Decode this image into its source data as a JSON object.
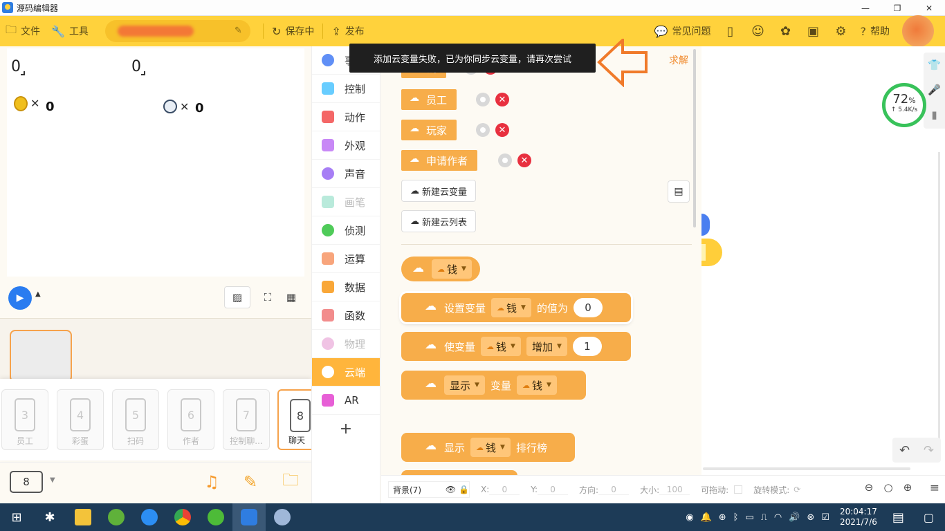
{
  "window": {
    "title": "源码编辑器",
    "controls": [
      "—",
      "❐",
      "✕"
    ]
  },
  "toolbar": {
    "file": "文件",
    "tools": "工具",
    "saving": "保存中",
    "publish": "发布",
    "faq": "常见问题",
    "help": "帮助"
  },
  "stage": {
    "var1": "0",
    "var2": "0",
    "coins": "0",
    "timer": "0",
    "x_mark": "✕"
  },
  "scenes": [
    {
      "num": "3",
      "label": "员工"
    },
    {
      "num": "4",
      "label": "彩蛋"
    },
    {
      "num": "5",
      "label": "扫码"
    },
    {
      "num": "6",
      "label": "作者"
    },
    {
      "num": "7",
      "label": "控制聊..."
    },
    {
      "num": "8",
      "label": "聊天"
    }
  ],
  "scene_selector": "8",
  "categories": [
    {
      "label": "事件",
      "color": "#608ff6",
      "disabled": false
    },
    {
      "label": "控制",
      "color": "#68cdff",
      "disabled": false
    },
    {
      "label": "动作",
      "color": "#f46767",
      "disabled": false
    },
    {
      "label": "外观",
      "color": "#c888f6",
      "disabled": false
    },
    {
      "label": "声音",
      "color": "#a77ef5",
      "disabled": false
    },
    {
      "label": "画笔",
      "color": "#7fd6bd",
      "disabled": true
    },
    {
      "label": "侦测",
      "color": "#4fcb59",
      "disabled": false
    },
    {
      "label": "运算",
      "color": "#f8a57c",
      "disabled": false
    },
    {
      "label": "数据",
      "color": "#f9a738",
      "disabled": false
    },
    {
      "label": "函数",
      "color": "#f28c8c",
      "disabled": false
    },
    {
      "label": "物理",
      "color": "#e08cc7",
      "disabled": true
    },
    {
      "label": "云端",
      "color": "#ffffff",
      "disabled": false
    },
    {
      "label": "AR",
      "color": "#e75fd6",
      "disabled": false
    }
  ],
  "palette": {
    "qiujie": "求解",
    "cloud_vars": [
      "钱",
      "员工",
      "玩家",
      "申请作者"
    ],
    "new_cloud_var": "新建云变量",
    "new_cloud_list": "新建云列表",
    "reporter_var": "钱",
    "set_block": {
      "prefix": "设置变量",
      "var": "钱",
      "middle": "的值为",
      "value": "0"
    },
    "change_block": {
      "prefix": "使变量",
      "var": "钱",
      "op": "增加",
      "value": "1"
    },
    "show_block": {
      "mode": "显示",
      "middle": "变量",
      "var": "钱"
    },
    "leaderboard_block": {
      "mode": "显示",
      "var": "钱",
      "suffix": "排行榜"
    }
  },
  "toast": "添加云变量失败，已为你同步云变量，请再次尝试",
  "network_gauge": {
    "percent": "72",
    "percent_unit": "%",
    "speed": "↑ 5.4K/s"
  },
  "statusbar": {
    "sprite": "背景(7)",
    "x_label": "X:",
    "x_val": "0",
    "y_label": "Y:",
    "y_val": "0",
    "dir_label": "方向:",
    "dir_val": "0",
    "size_label": "大小:",
    "size_val": "100",
    "drag_label": "可拖动:",
    "rotate_label": "旋转模式:"
  },
  "taskbar": {
    "time": "20:04:17",
    "date": "2021/7/6"
  }
}
